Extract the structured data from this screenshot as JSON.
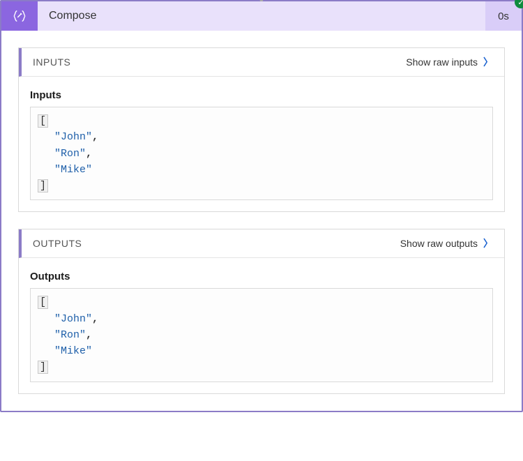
{
  "header": {
    "title": "Compose",
    "duration": "0s"
  },
  "inputs_section": {
    "title": "INPUTS",
    "link_label": "Show raw inputs",
    "field_label": "Inputs",
    "values": [
      "John",
      "Ron",
      "Mike"
    ]
  },
  "outputs_section": {
    "title": "OUTPUTS",
    "link_label": "Show raw outputs",
    "field_label": "Outputs",
    "values": [
      "John",
      "Ron",
      "Mike"
    ]
  }
}
